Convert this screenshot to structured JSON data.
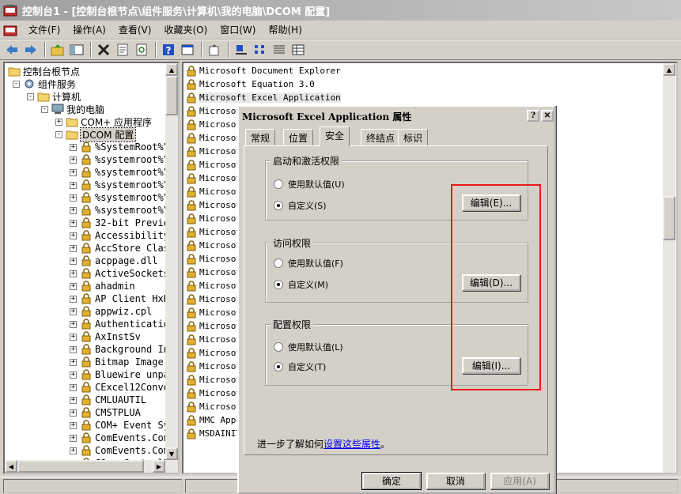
{
  "window": {
    "title": "控制台1 - [控制台根节点\\组件服务\\计算机\\我的电脑\\DCOM 配置]"
  },
  "menubar": {
    "items": [
      "文件(F)",
      "操作(A)",
      "查看(V)",
      "收藏夹(O)",
      "窗口(W)",
      "帮助(H)"
    ]
  },
  "toolbar": {
    "icons": [
      "back-arrow-icon",
      "forward-arrow-icon",
      "up-folder-icon",
      "show-hide-tree-icon",
      "delete-icon",
      "properties-icon",
      "refresh-icon",
      "help-icon",
      "new-window-icon",
      "export-icon",
      "large-icons-view-icon",
      "small-icons-view-icon",
      "list-view-icon",
      "details-view-icon"
    ]
  },
  "tree": {
    "root": "控制台根节点",
    "component_services": "组件服务",
    "computers": "计算机",
    "my_computer": "我的电脑",
    "com_apps": "COM+ 应用程序",
    "dcom_config": "DCOM 配置",
    "dcom_items": [
      "%SystemRoot%\\s",
      "%systemroot%\\s",
      "%systemroot%\\s",
      "%systemroot%\\s",
      "%systemroot%\\S",
      "%systemroot%\\S",
      "32-bit Preview",
      "AccessibilityC",
      "AccStore Class",
      "acppage.dll",
      "ActiveSockets",
      "ahadmin",
      "AP Client HxHe",
      "appwiz.cpl",
      "Authenticatio",
      "AxInstSv",
      "Background Int",
      "Bitmap Image",
      "Bluewire unpai",
      "CExcel12Conver",
      "CMLUAUTIL",
      "CMSTPLUA",
      "COM+ Event Sys",
      "ComEvents.ComS",
      "ComEvents.ComS",
      "COpenControlPa"
    ]
  },
  "list": {
    "items": [
      "Microsoft Document Explorer",
      "Microsoft Equation 3.0",
      "Microsoft Excel Application",
      "Microsof",
      "Microsof",
      "Microsof",
      "Microsof",
      "Microsof",
      "Microsof",
      "Microsof",
      "Microsof",
      "Microsof",
      "Microsof",
      "Microsof",
      "Microsof",
      "Microsof",
      "Microsof",
      "Microsof",
      "Microsof",
      "Microsof",
      "Microsof",
      "Microsof",
      "Microsof",
      "Microsof",
      "Microsof",
      "Microsof",
      "MMC Appl",
      "MSDAINIT"
    ],
    "selected_index": 2
  },
  "dialog": {
    "title": "Microsoft Excel Application 属性",
    "help_button": "?",
    "close_button": "✕",
    "tabs": [
      "常规",
      "位置",
      "安全",
      "终结点",
      "标识"
    ],
    "active_tab": 2,
    "groups": [
      {
        "title": "启动和激活权限",
        "default_label": "使用默认值(U)",
        "custom_label": "自定义(S)",
        "edit_label": "编辑(E)..."
      },
      {
        "title": "访问权限",
        "default_label": "使用默认值(F)",
        "custom_label": "自定义(M)",
        "edit_label": "编辑(D)..."
      },
      {
        "title": "配置权限",
        "default_label": "使用默认值(L)",
        "custom_label": "自定义(T)",
        "edit_label": "编辑(I)..."
      }
    ],
    "learn_more_prefix": "进一步了解如何",
    "learn_more_link": "设置这些属性",
    "learn_more_suffix": "。",
    "ok_label": "确定",
    "cancel_label": "取消",
    "apply_label": "应用(A)"
  },
  "colors": {
    "highlight_box": "#e81c1c",
    "link": "#0000ee"
  }
}
